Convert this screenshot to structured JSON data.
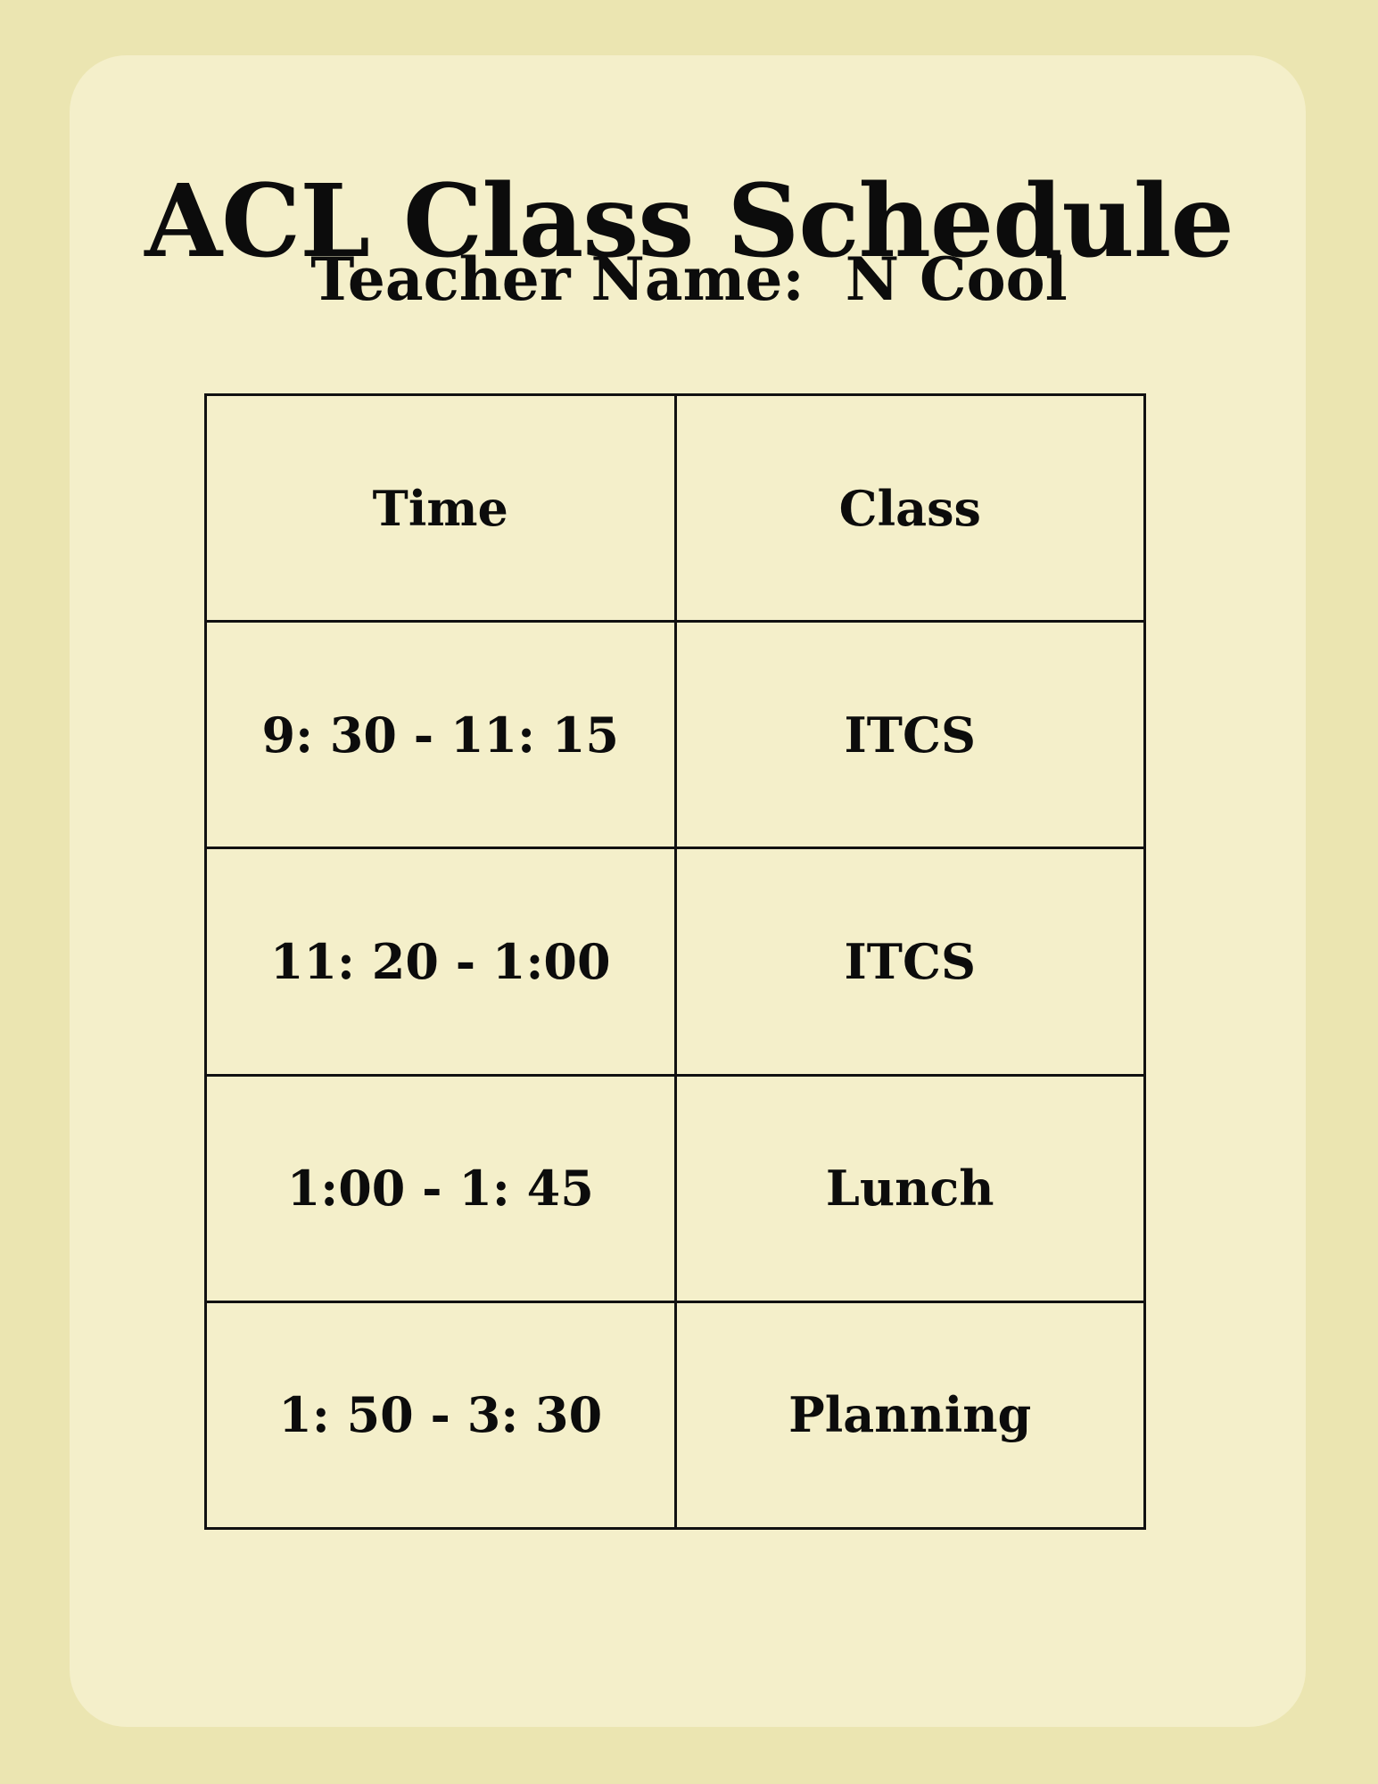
{
  "document": {
    "title": "ACL Class Schedule",
    "subtitle": "Teacher Name:  N Cool"
  },
  "table": {
    "headers": [
      "Time",
      "Class"
    ],
    "rows": [
      {
        "time": "9: 30 - 11: 15",
        "class": "ITCS"
      },
      {
        "time": "11: 20 - 1:00",
        "class": "ITCS"
      },
      {
        "time": "1:00 - 1: 45",
        "class": "Lunch"
      },
      {
        "time": "1: 50 - 3: 30",
        "class": "Planning"
      }
    ]
  },
  "colors": {
    "page_background": "#ebe5b1",
    "card_background": "#f4efca",
    "text": "#0c0c0c",
    "table_border": "#111111"
  }
}
